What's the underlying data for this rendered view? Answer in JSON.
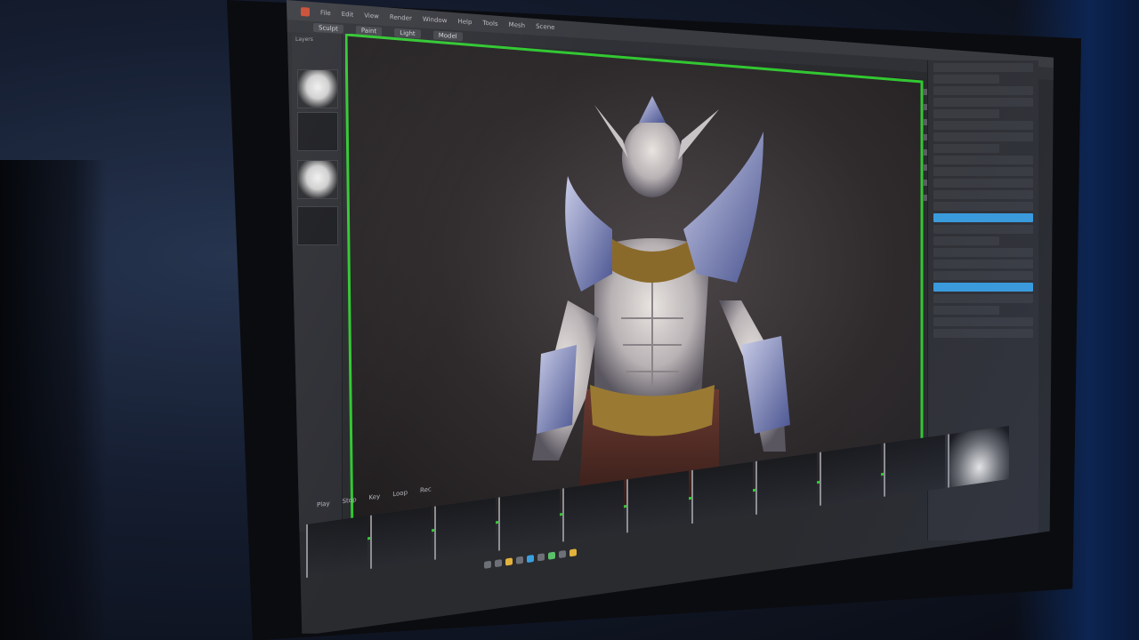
{
  "scene": {
    "description_tokens": [
      "3d-software-monitor",
      "character-model"
    ]
  },
  "menubar": {
    "items": [
      "File",
      "Edit",
      "View",
      "Render",
      "Window",
      "Help",
      "Tools",
      "Mesh",
      "Scene"
    ]
  },
  "tabs": {
    "items": [
      "Sculpt",
      "Paint",
      "Light",
      "Model"
    ]
  },
  "left_panel": {
    "header": "Layers"
  },
  "timeline": {
    "controls": [
      "Play",
      "Stop",
      "Key",
      "Loop",
      "Rec"
    ]
  },
  "colors": {
    "viewport_border": "#32c832",
    "selection_blue": "#3a9bdc",
    "panel": "#303137",
    "background": "#141c2e"
  }
}
